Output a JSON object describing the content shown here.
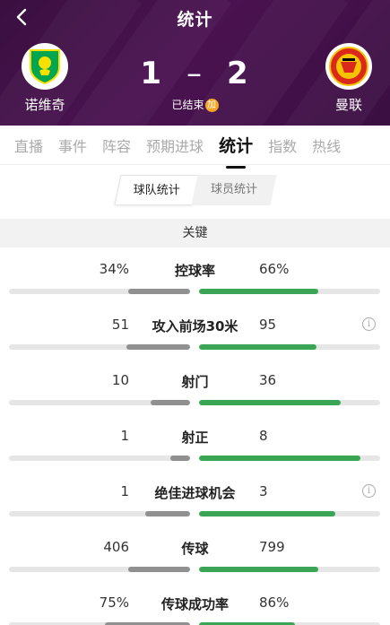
{
  "header": {
    "title": "统计",
    "home_team": "诺维奇",
    "away_team": "曼联",
    "home_score": "1",
    "score_separator": "–",
    "away_score": "2",
    "status": "已结束",
    "status_badge": "加"
  },
  "tabs": [
    {
      "label": "直播",
      "active": false
    },
    {
      "label": "事件",
      "active": false
    },
    {
      "label": "阵容",
      "active": false
    },
    {
      "label": "预期进球",
      "active": false
    },
    {
      "label": "统计",
      "active": true
    },
    {
      "label": "指数",
      "active": false
    },
    {
      "label": "热线",
      "active": false
    }
  ],
  "segment": {
    "team_stats": "球队统计",
    "player_stats": "球员统计"
  },
  "section": {
    "title": "关键"
  },
  "colors": {
    "header_bg": "#3f1147",
    "home_bar": "#909090",
    "away_bar": "#3aa655",
    "track": "#e6e6e6"
  },
  "stats": [
    {
      "label": "控球率",
      "home": "34%",
      "away": "66%",
      "home_share": 0.34,
      "away_share": 0.66,
      "info": false
    },
    {
      "label": "攻入前场30米",
      "home": "51",
      "away": "95",
      "home_share": 0.35,
      "away_share": 0.65,
      "info": true
    },
    {
      "label": "射门",
      "home": "10",
      "away": "36",
      "home_share": 0.22,
      "away_share": 0.78,
      "info": false
    },
    {
      "label": "射正",
      "home": "1",
      "away": "8",
      "home_share": 0.11,
      "away_share": 0.89,
      "info": false
    },
    {
      "label": "绝佳进球机会",
      "home": "1",
      "away": "3",
      "home_share": 0.25,
      "away_share": 0.75,
      "info": true
    },
    {
      "label": "传球",
      "home": "406",
      "away": "799",
      "home_share": 0.34,
      "away_share": 0.66,
      "info": false
    },
    {
      "label": "传球成功率",
      "home": "75%",
      "away": "86%",
      "home_share": 0.47,
      "away_share": 0.53,
      "info": false
    }
  ]
}
